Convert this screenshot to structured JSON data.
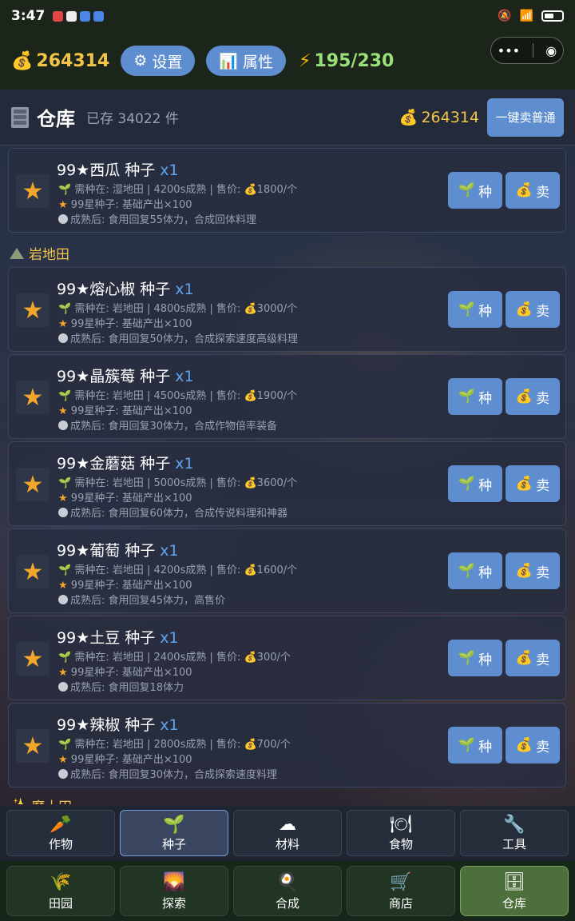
{
  "status": {
    "time": "3:47"
  },
  "topbar": {
    "gold": "264314",
    "settings_label": "设置",
    "attributes_label": "属性",
    "energy": "195/230"
  },
  "warehouse": {
    "title": "仓库",
    "stored": "已存 34022 件",
    "gold": "264314",
    "sell_all_label": "一键卖普通"
  },
  "sections": [
    {
      "title": "岩地田"
    },
    {
      "title": "魔土田"
    }
  ],
  "items": [
    {
      "name": "99★西瓜 种子",
      "qty": "x1",
      "l1": "需种在: 湿地田 | 4200s成熟 | 售价: 💰1800/个",
      "l2": "99星种子: 基础产出×100",
      "l3": "成熟后: 食用回复55体力，合成回体料理"
    },
    {
      "name": "99★熔心椒 种子",
      "qty": "x1",
      "l1": "需种在: 岩地田 | 4800s成熟 | 售价: 💰3000/个",
      "l2": "99星种子: 基础产出×100",
      "l3": "成熟后: 食用回复50体力，合成探索速度高级料理"
    },
    {
      "name": "99★晶簇莓 种子",
      "qty": "x1",
      "l1": "需种在: 岩地田 | 4500s成熟 | 售价: 💰1900/个",
      "l2": "99星种子: 基础产出×100",
      "l3": "成熟后: 食用回复30体力，合成作物倍率装备"
    },
    {
      "name": "99★金蘑菇 种子",
      "qty": "x1",
      "l1": "需种在: 岩地田 | 5000s成熟 | 售价: 💰3600/个",
      "l2": "99星种子: 基础产出×100",
      "l3": "成熟后: 食用回复60体力，合成传说料理和神器"
    },
    {
      "name": "99★葡萄 种子",
      "qty": "x1",
      "l1": "需种在: 岩地田 | 4200s成熟 | 售价: 💰1600/个",
      "l2": "99星种子: 基础产出×100",
      "l3": "成熟后: 食用回复45体力，高售价"
    },
    {
      "name": "99★土豆 种子",
      "qty": "x1",
      "l1": "需种在: 岩地田 | 2400s成熟 | 售价: 💰300/个",
      "l2": "99星种子: 基础产出×100",
      "l3": "成熟后: 食用回复18体力"
    },
    {
      "name": "99★辣椒 种子",
      "qty": "x1",
      "l1": "需种在: 岩地田 | 2800s成熟 | 售价: 💰700/个",
      "l2": "99星种子: 基础产出×100",
      "l3": "成熟后: 食用回复30体力，合成探索速度料理"
    }
  ],
  "buttons": {
    "plant": "种",
    "sell": "卖"
  },
  "categories": [
    {
      "label": "作物",
      "icon": "carrot-icon"
    },
    {
      "label": "种子",
      "icon": "sprout-icon"
    },
    {
      "label": "材料",
      "icon": "cloud-icon"
    },
    {
      "label": "食物",
      "icon": "plate-icon"
    },
    {
      "label": "工具",
      "icon": "wrench-icon"
    }
  ],
  "nav": [
    {
      "label": "田园",
      "icon": "wheat-icon"
    },
    {
      "label": "探索",
      "icon": "landscape-icon"
    },
    {
      "label": "合成",
      "icon": "cooking-icon"
    },
    {
      "label": "商店",
      "icon": "cart-icon"
    },
    {
      "label": "仓库",
      "icon": "cabinet-icon"
    }
  ],
  "colors": {
    "accent": "#5f8ed0",
    "gold": "#f2c44a",
    "energy": "#9ae07a",
    "star": "#f4a62a"
  }
}
